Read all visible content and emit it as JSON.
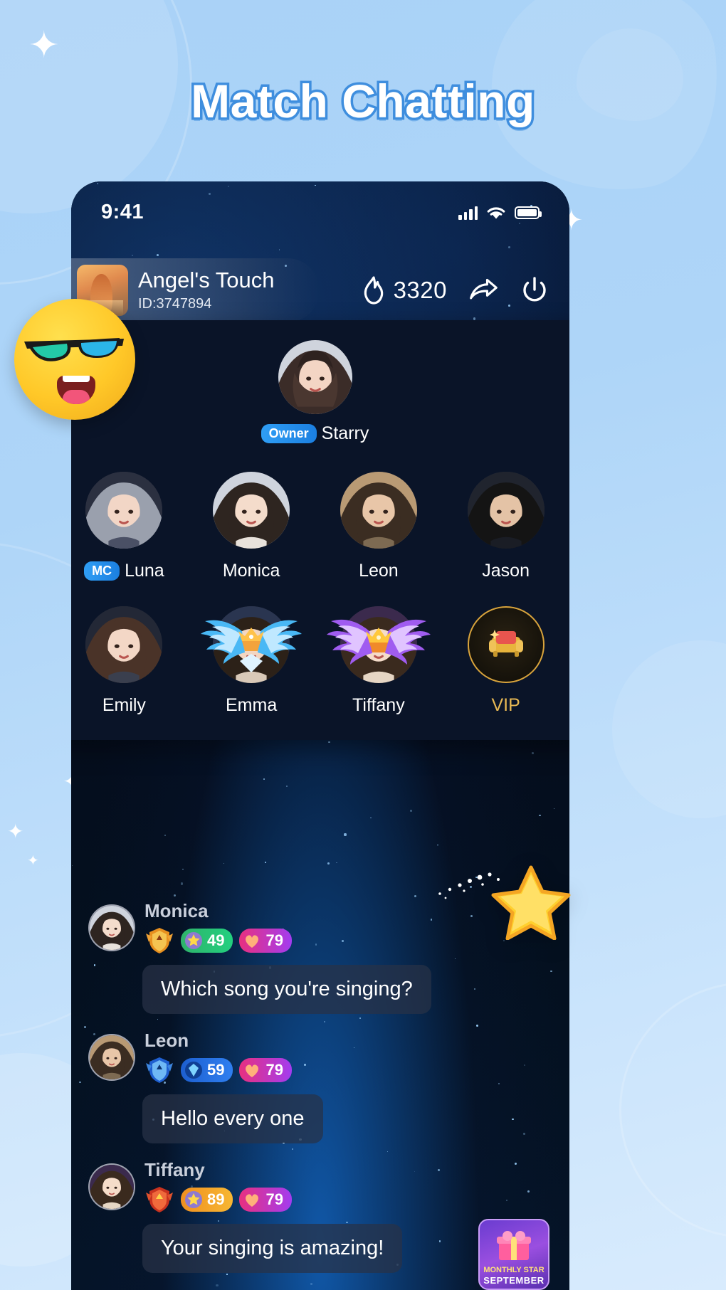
{
  "page": {
    "title": "Match Chatting",
    "accent_blue": "#3f8ede",
    "background": "#aed5f8"
  },
  "phone": {
    "status_bar": {
      "time": "9:41",
      "signal_icon": "cellular-signal-icon",
      "wifi_icon": "wifi-icon",
      "battery_icon": "battery-icon"
    },
    "room_header": {
      "avatar_icon": "room-avatar",
      "name": "Angel's Touch",
      "id": "ID:3747894",
      "hot_icon": "flame-icon",
      "hot_count": "3320",
      "share_icon": "share-arrow-icon",
      "power_icon": "power-off-icon"
    },
    "member_panel": {
      "owner": {
        "badge": "Owner",
        "name": "Starry",
        "avatar": "owner-avatar"
      },
      "members": [
        {
          "name": "Luna",
          "badge": "MC",
          "frame": "none",
          "type": "member"
        },
        {
          "name": "Monica",
          "badge": "",
          "frame": "none",
          "type": "member"
        },
        {
          "name": "Leon",
          "badge": "",
          "frame": "none",
          "type": "member"
        },
        {
          "name": "Jason",
          "badge": "",
          "frame": "none",
          "type": "member"
        },
        {
          "name": "Emily",
          "badge": "",
          "frame": "none",
          "type": "member"
        },
        {
          "name": "Emma",
          "badge": "",
          "frame": "blue-wings",
          "type": "member"
        },
        {
          "name": "Tiffany",
          "badge": "",
          "frame": "purple-wings",
          "type": "member"
        },
        {
          "name": "VIP",
          "badge": "",
          "frame": "none",
          "type": "vip-seat"
        }
      ]
    },
    "chat": {
      "messages": [
        {
          "name": "Monica",
          "crest": "gold-crest-icon",
          "level_badge": {
            "icon": "star-medal-icon",
            "value": "49",
            "style": "lvl-green"
          },
          "heart_badge": {
            "icon": "heart-icon",
            "value": "79"
          },
          "text": "Which song you're singing?"
        },
        {
          "name": "Leon",
          "crest": "blue-crest-icon",
          "level_badge": {
            "icon": "diamond-icon",
            "value": "59",
            "style": "lvl-blue"
          },
          "heart_badge": {
            "icon": "heart-icon",
            "value": "79"
          },
          "text": "Hello every one"
        },
        {
          "name": "Tiffany",
          "crest": "red-crest-icon",
          "level_badge": {
            "icon": "star-medal-icon",
            "value": "89",
            "style": "lvl-orange"
          },
          "heart_badge": {
            "icon": "heart-icon",
            "value": "79"
          },
          "text": "Your singing is amazing!"
        }
      ],
      "monthly_card": {
        "line1": "MONTHLY STAR",
        "line2": "SEPTEMBER"
      }
    }
  },
  "decorations": {
    "emoji": "sunglasses-smiley-emoji",
    "star": "gold-star-sticker",
    "sparkles": [
      "sparkle-1",
      "sparkle-2",
      "sparkle-3",
      "sparkle-4",
      "sparkle-5"
    ]
  }
}
